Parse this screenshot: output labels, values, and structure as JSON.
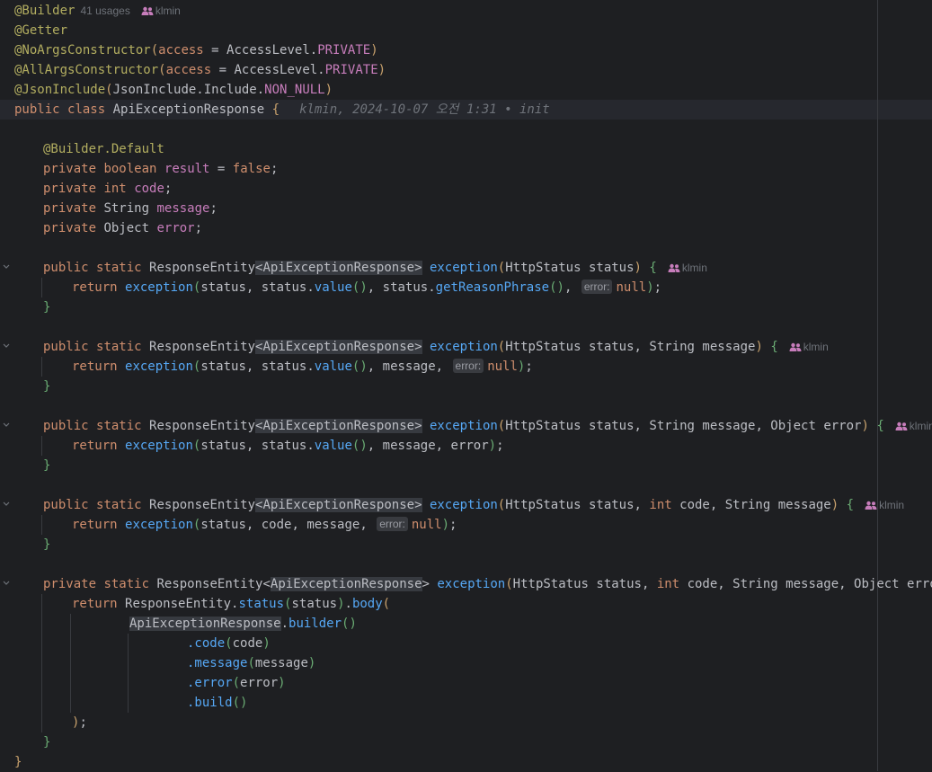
{
  "editor": {
    "class_header": {
      "annotation_builder": "@Builder",
      "usages": "41 usages",
      "author": "klmin",
      "annotation_getter": "@Getter",
      "noargs": "@NoArgsConstructor",
      "allargs": "@AllArgsConstructor",
      "access_kw": "access",
      "eq": " = ",
      "access_level": "AccessLevel.",
      "private_const": "PRIVATE",
      "jsoninclude": "@JsonInclude",
      "jsoninclude_arg": "JsonInclude.Include.",
      "non_null": "NON_NULL",
      "public": "public",
      "class": "class",
      "class_name": "ApiExceptionResponse",
      "blame": "klmin, 2024-10-07 오전 1:31 • init"
    },
    "fields": {
      "builder_default": "@Builder.Default",
      "private": "private",
      "boolean": "boolean",
      "result": "result",
      "false": "false",
      "int": "int",
      "code": "code",
      "string": "String",
      "message": "message",
      "object": "Object",
      "error": "error"
    },
    "methods": {
      "public": "public",
      "private": "private",
      "static": "static",
      "return": "return",
      "response_entity": "ResponseEntity",
      "generic": "ApiExceptionResponse",
      "exception": "exception",
      "http_status": "HttpStatus",
      "status": "status",
      "value": "value",
      "get_reason": "getReasonPhrase",
      "null": "null",
      "hint_error": "error:",
      "author": "klmin",
      "status_call": "status",
      "body": "body",
      "builder": "builder",
      "code_call": ".code",
      "message_call": ".message",
      "error_call": ".error",
      "build_call": ".build"
    }
  }
}
